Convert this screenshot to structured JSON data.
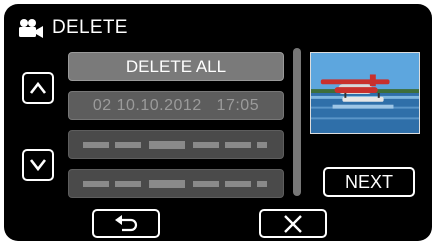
{
  "header": {
    "title": "DELETE",
    "icon": "video-camera-icon"
  },
  "nav": {
    "up_icon": "chevron-up-icon",
    "down_icon": "chevron-down-icon"
  },
  "list": {
    "delete_all_label": "DELETE ALL",
    "items": [
      {
        "label": "02 10.10.2012   17:05"
      }
    ]
  },
  "buttons": {
    "next_label": "NEXT",
    "back_icon": "return-arrow-icon",
    "close_icon": "close-icon"
  },
  "thumbnail": {
    "icon": "seaplane-thumbnail"
  }
}
